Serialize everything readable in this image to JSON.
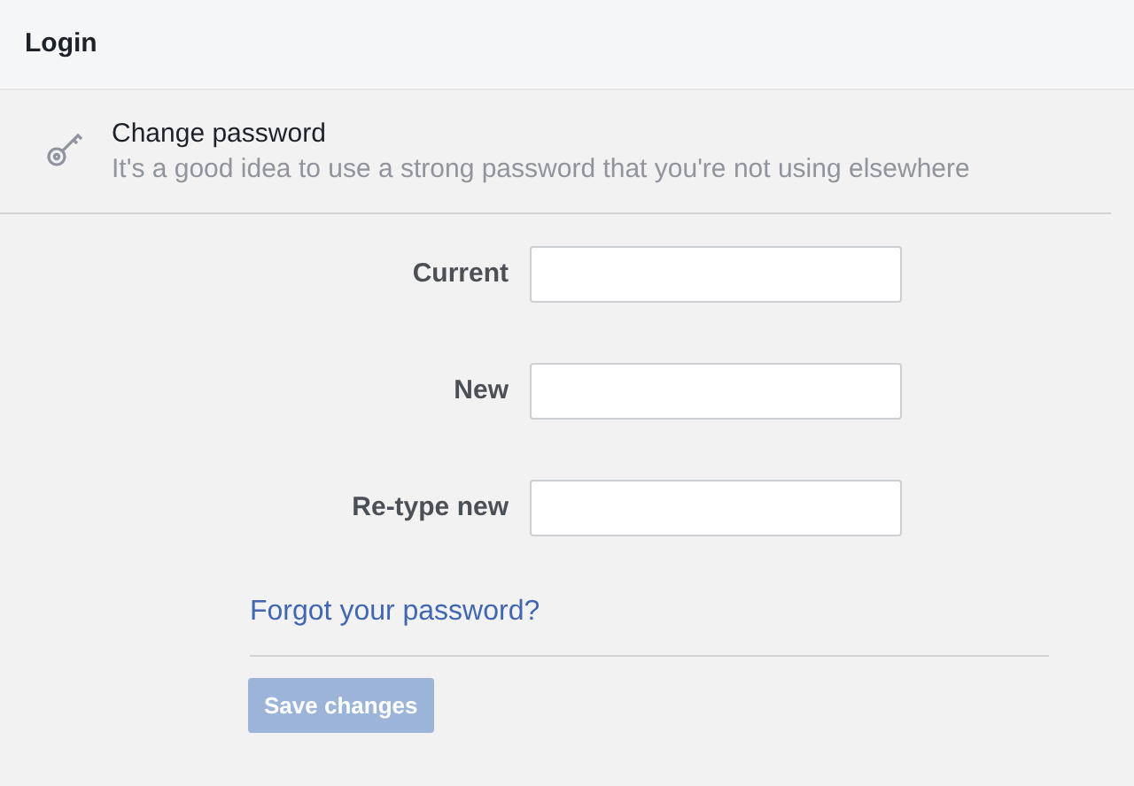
{
  "header": {
    "title": "Login"
  },
  "section": {
    "title": "Change password",
    "description": "It's a good idea to use a strong password that you're not using elsewhere"
  },
  "fields": [
    {
      "label": "Current"
    },
    {
      "label": "New"
    },
    {
      "label": "Re-type new"
    }
  ],
  "forgot_link": "Forgot your password?",
  "save_button": {
    "label": "Save changes",
    "disabled": true
  }
}
